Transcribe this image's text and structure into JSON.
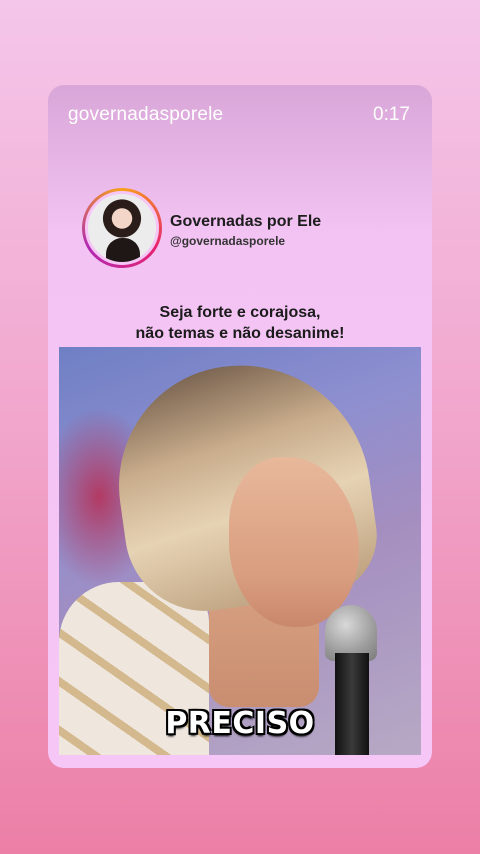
{
  "header": {
    "account_name": "governadasporele",
    "timer": "0:17"
  },
  "profile": {
    "title": "Governadas por Ele",
    "handle": "@governadasporele",
    "avatar_icon": "profile-photo"
  },
  "caption": {
    "line1": "Seja forte e corajosa,",
    "line2": "não temas e não desanime!"
  },
  "video": {
    "subtitle": "PRECISO"
  },
  "colors": {
    "background_top": "#f4c6ea",
    "background_bottom": "#ec7fa6",
    "card": "#f6c6f6"
  }
}
